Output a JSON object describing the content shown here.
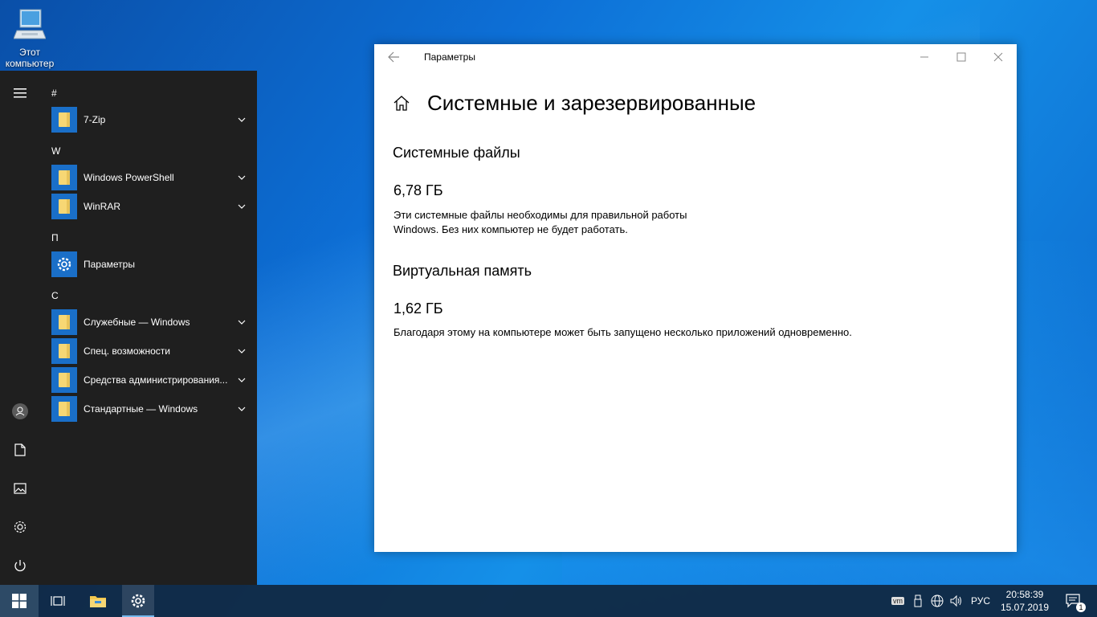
{
  "desktop": {
    "icon_label_line1": "Этот",
    "icon_label_line2": "компьютер"
  },
  "start_menu": {
    "groups": [
      {
        "header": "#",
        "apps": [
          {
            "label": "7-Zip",
            "icon": "folder-icon",
            "expandable": true
          }
        ]
      },
      {
        "header": "W",
        "apps": [
          {
            "label": "Windows PowerShell",
            "icon": "folder-icon",
            "expandable": true
          },
          {
            "label": "WinRAR",
            "icon": "folder-icon",
            "expandable": true
          }
        ]
      },
      {
        "header": "П",
        "apps": [
          {
            "label": "Параметры",
            "icon": "gear-icon",
            "expandable": false
          }
        ]
      },
      {
        "header": "С",
        "apps": [
          {
            "label": "Служебные — Windows",
            "icon": "folder-icon",
            "expandable": true
          },
          {
            "label": "Спец. возможности",
            "icon": "folder-icon",
            "expandable": true
          },
          {
            "label": "Средства администрирования...",
            "icon": "folder-icon",
            "expandable": true
          },
          {
            "label": "Стандартные — Windows",
            "icon": "folder-icon",
            "expandable": true
          }
        ]
      }
    ],
    "rail_icons": [
      "hamburger-icon",
      "user-icon",
      "documents-icon",
      "pictures-icon",
      "settings-icon",
      "power-icon"
    ]
  },
  "settings_window": {
    "title": "Параметры",
    "page_title": "Системные и зарезервированные",
    "sections": [
      {
        "title": "Системные файлы",
        "size": "6,78 ГБ",
        "desc_line1": "Эти системные файлы необходимы для правильной работы",
        "desc_line2": "Windows. Без них компьютер не будет работать."
      },
      {
        "title": "Виртуальная память",
        "size": "1,62 ГБ",
        "desc_line1": "Благодаря этому на компьютере может быть запущено несколько приложений одновременно.",
        "desc_line2": ""
      }
    ]
  },
  "taskbar": {
    "language": "РУС",
    "time": "20:58:39",
    "date": "15.07.2019",
    "notification_count": "1",
    "tray_vm_label": "vm"
  },
  "colors": {
    "accent": "#1a6fc8",
    "start_bg": "#1f1f1f",
    "taskbar_bg": "#10263e"
  }
}
